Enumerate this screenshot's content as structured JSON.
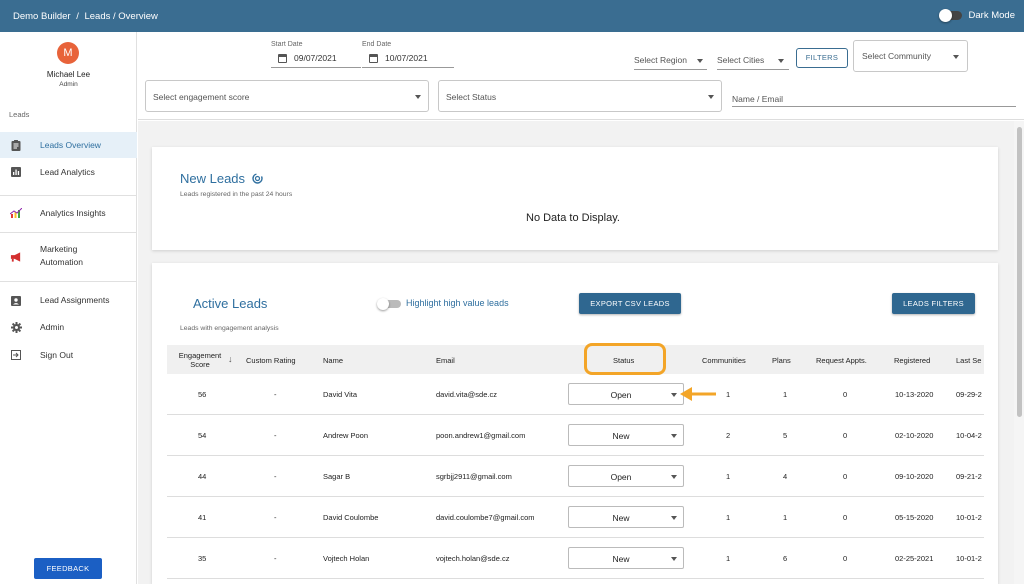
{
  "topbar": {
    "breadcrumb": [
      "Demo Builder",
      "/",
      "Leads / Overview"
    ],
    "dark_mode_label": "Dark Mode"
  },
  "sidebar": {
    "avatar_letter": "M",
    "user_name": "Michael Lee",
    "user_role": "Admin",
    "section_label": "Leads",
    "items": [
      {
        "label": "Leads Overview",
        "icon": "clipboard-icon",
        "active": true
      },
      {
        "label": "Lead Analytics",
        "icon": "bar-chart-icon",
        "active": false
      },
      {
        "label": "Analytics Insights",
        "icon": "insights-chart-icon",
        "active": false
      },
      {
        "label": "Marketing",
        "label2": "Automation",
        "icon": "megaphone-icon",
        "active": false
      },
      {
        "label": "Lead Assignments",
        "icon": "assignment-ind-icon",
        "active": false
      },
      {
        "label": "Admin",
        "icon": "gear-icon",
        "active": false
      },
      {
        "label": "Sign Out",
        "icon": "exit-icon",
        "active": false
      }
    ],
    "feedback_label": "FEEDBACK"
  },
  "filters": {
    "start_date_label": "Start Date",
    "start_date_value": "09/07/2021",
    "end_date_label": "End Date",
    "end_date_value": "10/07/2021",
    "region_placeholder": "Select Region",
    "cities_placeholder": "Select Cities",
    "filters_button": "FILTERS",
    "community_placeholder": "Select Community",
    "engagement_placeholder": "Select engagement score",
    "status_placeholder": "Select Status",
    "name_email_placeholder": "Name / Email"
  },
  "new_leads": {
    "title": "New Leads",
    "subtitle": "Leads registered in the past 24 hours",
    "empty_message": "No Data to Display."
  },
  "active_leads": {
    "title": "Active Leads",
    "subtitle": "Leads with engagement analysis",
    "highlight_label": "Highlight high value leads",
    "export_button": "EXPORT CSV LEADS",
    "filters_button": "LEADS FILTERS",
    "columns": {
      "engagement": "Engagement",
      "score": "Score",
      "custom_rating": "Custom Rating",
      "name": "Name",
      "email": "Email",
      "status": "Status",
      "communities": "Communities",
      "plans": "Plans",
      "request_appts": "Request Appts.",
      "registered": "Registered",
      "last_seen": "Last Se"
    },
    "rows": [
      {
        "score": "56",
        "rating": "-",
        "name": "David Vita",
        "email": "david.vita@sde.cz",
        "status": "Open",
        "communities": "1",
        "plans": "1",
        "appts": "0",
        "registered": "10-13-2020",
        "last": "09-29-2"
      },
      {
        "score": "54",
        "rating": "-",
        "name": "Andrew Poon",
        "email": "poon.andrew1@gmail.com",
        "status": "New",
        "communities": "2",
        "plans": "5",
        "appts": "0",
        "registered": "02-10-2020",
        "last": "10-04-2"
      },
      {
        "score": "44",
        "rating": "-",
        "name": "Sagar B",
        "email": "sgrbjj2911@gmail.com",
        "status": "Open",
        "communities": "1",
        "plans": "4",
        "appts": "0",
        "registered": "09-10-2020",
        "last": "09-21-2"
      },
      {
        "score": "41",
        "rating": "-",
        "name": "David Coulombe",
        "email": "david.coulombe7@gmail.com",
        "status": "New",
        "communities": "1",
        "plans": "1",
        "appts": "0",
        "registered": "05-15-2020",
        "last": "10-01-2"
      },
      {
        "score": "35",
        "rating": "-",
        "name": "Vojtech Holan",
        "email": "vojtech.holan@sde.cz",
        "status": "New",
        "communities": "1",
        "plans": "6",
        "appts": "0",
        "registered": "02-25-2021",
        "last": "10-01-2"
      }
    ]
  },
  "colors": {
    "topbar": "#3a6d91",
    "accent": "#2f6f9f",
    "avatar": "#e8633a",
    "annotation": "#f3a528",
    "feedback": "#1b5fc4"
  }
}
